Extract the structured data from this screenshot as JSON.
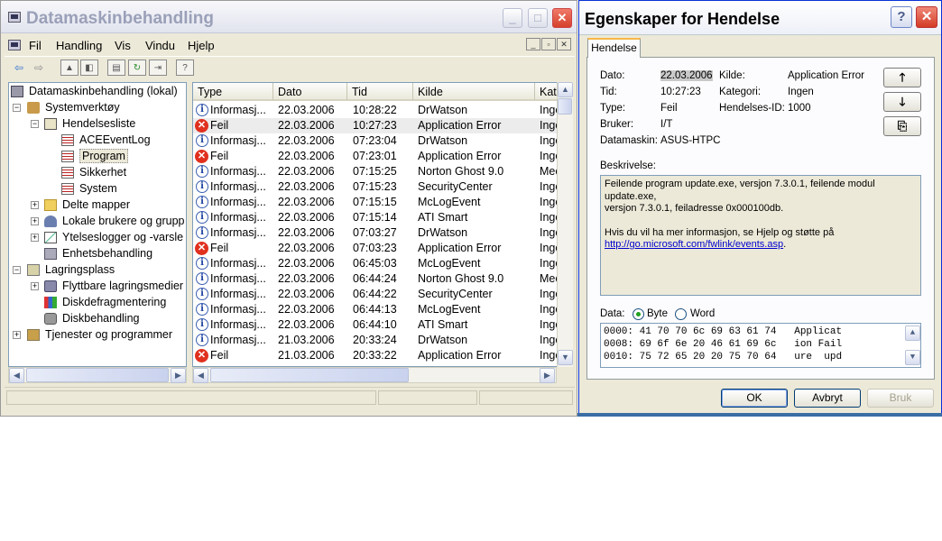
{
  "main_window": {
    "title": "Datamaskinbehandling",
    "controls": {
      "minimize": "_",
      "maximize": "□",
      "close": "✕"
    },
    "menu": [
      "Fil",
      "Handling",
      "Vis",
      "Vindu",
      "Hjelp"
    ],
    "mdi_controls": [
      "_",
      "▫",
      "✕"
    ]
  },
  "tree": {
    "nodes": [
      {
        "label": "Datamaskinbehandling (lokal)",
        "icon": "computer-icon"
      },
      {
        "label": "Systemverktøy",
        "icon": "tools-icon"
      },
      {
        "label": "Hendelsesliste",
        "icon": "event-viewer-icon"
      },
      {
        "label": "ACEEventLog",
        "icon": "log-icon"
      },
      {
        "label": "Program",
        "icon": "log-icon"
      },
      {
        "label": "Sikkerhet",
        "icon": "log-icon"
      },
      {
        "label": "System",
        "icon": "log-icon"
      },
      {
        "label": "Delte mapper",
        "icon": "shared-folder-icon"
      },
      {
        "label": "Lokale brukere og grupp",
        "icon": "users-icon"
      },
      {
        "label": "Ytelseslogger og -varsle",
        "icon": "performance-icon"
      },
      {
        "label": "Enhetsbehandling",
        "icon": "device-manager-icon"
      },
      {
        "label": "Lagringsplass",
        "icon": "storage-icon"
      },
      {
        "label": "Flyttbare lagringsmedier",
        "icon": "removable-storage-icon"
      },
      {
        "label": "Diskdefragmentering",
        "icon": "defrag-icon"
      },
      {
        "label": "Diskbehandling",
        "icon": "disk-icon"
      },
      {
        "label": "Tjenester og programmer",
        "icon": "services-icon"
      }
    ]
  },
  "list": {
    "columns": [
      "Type",
      "Dato",
      "Tid",
      "Kilde",
      "Kate"
    ],
    "rows": [
      {
        "type": "Informasj...",
        "date": "22.03.2006",
        "time": "10:28:22",
        "source": "DrWatson",
        "cat": "Inge"
      },
      {
        "type": "Feil",
        "date": "22.03.2006",
        "time": "10:27:23",
        "source": "Application Error",
        "cat": "Inge"
      },
      {
        "type": "Informasj...",
        "date": "22.03.2006",
        "time": "07:23:04",
        "source": "DrWatson",
        "cat": "Inge"
      },
      {
        "type": "Feil",
        "date": "22.03.2006",
        "time": "07:23:01",
        "source": "Application Error",
        "cat": "Inge"
      },
      {
        "type": "Informasj...",
        "date": "22.03.2006",
        "time": "07:15:25",
        "source": "Norton Ghost 9.0",
        "cat": "Mec"
      },
      {
        "type": "Informasj...",
        "date": "22.03.2006",
        "time": "07:15:23",
        "source": "SecurityCenter",
        "cat": "Inge"
      },
      {
        "type": "Informasj...",
        "date": "22.03.2006",
        "time": "07:15:15",
        "source": "McLogEvent",
        "cat": "Inge"
      },
      {
        "type": "Informasj...",
        "date": "22.03.2006",
        "time": "07:15:14",
        "source": "ATI Smart",
        "cat": "Inge"
      },
      {
        "type": "Informasj...",
        "date": "22.03.2006",
        "time": "07:03:27",
        "source": "DrWatson",
        "cat": "Inge"
      },
      {
        "type": "Feil",
        "date": "22.03.2006",
        "time": "07:03:23",
        "source": "Application Error",
        "cat": "Inge"
      },
      {
        "type": "Informasj...",
        "date": "22.03.2006",
        "time": "06:45:03",
        "source": "McLogEvent",
        "cat": "Inge"
      },
      {
        "type": "Informasj...",
        "date": "22.03.2006",
        "time": "06:44:24",
        "source": "Norton Ghost 9.0",
        "cat": "Mec"
      },
      {
        "type": "Informasj...",
        "date": "22.03.2006",
        "time": "06:44:22",
        "source": "SecurityCenter",
        "cat": "Inge"
      },
      {
        "type": "Informasj...",
        "date": "22.03.2006",
        "time": "06:44:13",
        "source": "McLogEvent",
        "cat": "Inge"
      },
      {
        "type": "Informasj...",
        "date": "22.03.2006",
        "time": "06:44:10",
        "source": "ATI Smart",
        "cat": "Inge"
      },
      {
        "type": "Informasj...",
        "date": "21.03.2006",
        "time": "20:33:24",
        "source": "DrWatson",
        "cat": "Inge"
      },
      {
        "type": "Feil",
        "date": "21.03.2006",
        "time": "20:33:22",
        "source": "Application Error",
        "cat": "Inge"
      }
    ]
  },
  "dialog": {
    "title": "Egenskaper for Hendelse",
    "help": "?",
    "close": "✕",
    "tab": "Hendelse",
    "fields": {
      "date_label": "Dato:",
      "date_value": "22.03.2006",
      "source_label": "Kilde:",
      "source_value": "Application Error",
      "time_label": "Tid:",
      "time_value": "10:27:23",
      "category_label": "Kategori:",
      "category_value": "Ingen",
      "type_label": "Type:",
      "type_value": "Feil",
      "event_id_label": "Hendelses-ID:",
      "event_id_value": "1000",
      "user_label": "Bruker:",
      "user_value": "I/T",
      "computer_label": "Datamaskin:",
      "computer_value": "ASUS-HTPC"
    },
    "nav": {
      "up": "🡑",
      "down": "🡓",
      "copy": "⎘"
    },
    "description_label": "Beskrivelse:",
    "description_line1": "Feilende program update.exe, versjon 7.3.0.1, feilende modul update.exe,",
    "description_line2": "versjon 7.3.0.1, feiladresse 0x000100db.",
    "description_line3": "Hvis du vil ha mer informasjon, se Hjelp og støtte på",
    "description_link": "http://go.microsoft.com/fwlink/events.asp",
    "description_link_suffix": ".",
    "data_label": "Data:",
    "radio_byte": "Byte",
    "radio_word": "Word",
    "hex_lines": [
      "0000: 41 70 70 6c 69 63 61 74   Applicat",
      "0008: 69 6f 6e 20 46 61 69 6c   ion Fail",
      "0010: 75 72 65 20 20 75 70 64   ure  upd"
    ],
    "buttons": {
      "ok": "OK",
      "cancel": "Avbryt",
      "apply": "Bruk"
    }
  }
}
